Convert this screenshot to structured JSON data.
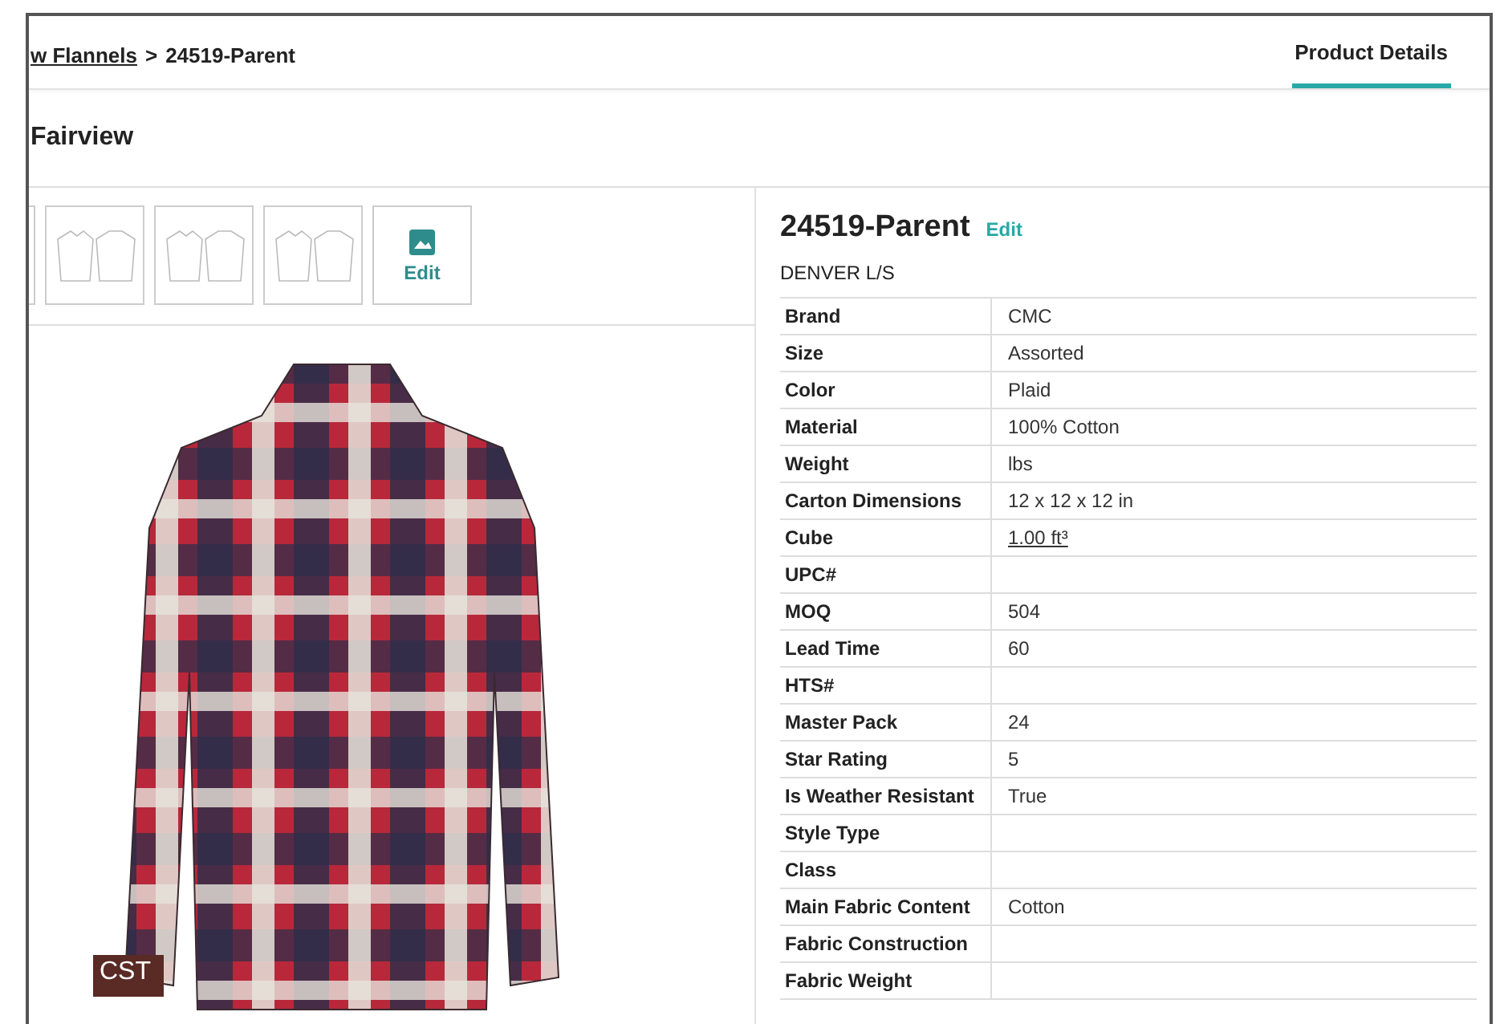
{
  "breadcrumb": {
    "link": "w Flannels",
    "separator": ">",
    "current": "24519-Parent"
  },
  "tabs": [
    {
      "label": "Product Details",
      "selected": true
    }
  ],
  "page_title": "Fairview",
  "gallery": {
    "tiles": [
      {
        "kind": "sketch"
      },
      {
        "kind": "sketch"
      },
      {
        "kind": "sketch"
      },
      {
        "kind": "sketch"
      },
      {
        "kind": "edit",
        "label": "Edit"
      }
    ],
    "badge": "CST"
  },
  "product": {
    "title": "24519-Parent",
    "edit_label": "Edit",
    "subtitle": "DENVER L/S",
    "attributes": [
      {
        "label": "Brand",
        "value": "CMC"
      },
      {
        "label": "Size",
        "value": "Assorted"
      },
      {
        "label": "Color",
        "value": "Plaid"
      },
      {
        "label": "Material",
        "value": "100% Cotton"
      },
      {
        "label": "Weight",
        "value": "lbs"
      },
      {
        "label": "Carton Dimensions",
        "value": "12 x 12 x 12 in"
      },
      {
        "label": "Cube",
        "value": "1.00 ft³",
        "kind": "link"
      },
      {
        "label": "UPC#"
      },
      {
        "label": "MOQ",
        "value": "504"
      },
      {
        "label": "Lead Time",
        "value": "60"
      },
      {
        "label": "HTS#"
      },
      {
        "label": "Master Pack",
        "value": "24"
      },
      {
        "label": "Star Rating",
        "value": "5"
      },
      {
        "label": "Is Weather Resistant",
        "value": "True"
      },
      {
        "label": "Style Type"
      },
      {
        "label": "Class"
      },
      {
        "label": "Main Fabric Content",
        "value": "Cotton"
      },
      {
        "label": "Fabric Construction"
      },
      {
        "label": "Fabric Weight"
      }
    ]
  }
}
